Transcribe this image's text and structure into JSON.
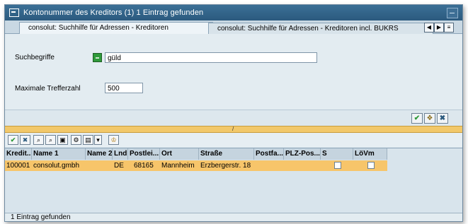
{
  "window": {
    "title": "Kontonummer des Kreditors (1)   1 Eintrag gefunden"
  },
  "tabs": [
    {
      "label": "consolut: Suchhilfe für Adressen - Kreditoren",
      "active": true
    },
    {
      "label": "consolut: Suchhilfe für Adressen - Kreditoren incl. BUKRS",
      "active": false
    }
  ],
  "search": {
    "suchbegriffe_label": "Suchbegriffe",
    "suchbegriffe_value": "güld",
    "max_label": "Maximale Trefferzahl",
    "max_value": "500"
  },
  "columns": [
    "Kredit...",
    "Name 1",
    "Name 2",
    "Lnd",
    "Postlei...",
    "Ort",
    "Straße",
    "Postfa...",
    "PLZ-Pos...",
    "S",
    "LöVm"
  ],
  "rows": [
    {
      "kredit": "100001",
      "name1": "consolut.gmbh",
      "name2": "",
      "lnd": "DE",
      "plz": "68165",
      "ort": "Mannheim",
      "strasse": "Erzbergerstr. 18",
      "postfach": "",
      "plzpos": "",
      "s": false,
      "loevm": false
    }
  ],
  "status": {
    "text": "1 Eintrag gefunden"
  },
  "colors": {
    "title_bar": "#2b5a7e",
    "row_highlight": "#f7c56a",
    "separator": "#f2c86a",
    "panel": "#e3ecf1"
  },
  "icons": [
    "window-icon",
    "minimize-icon",
    "tab-left-icon",
    "tab-right-icon",
    "tab-list-icon",
    "continue-check-icon",
    "multi-select-icon",
    "cancel-icon",
    "apply-check-icon",
    "cancel-x-icon",
    "find-icon",
    "find-next-icon",
    "save-icon",
    "settings-icon",
    "print-icon",
    "dropdown-icon",
    "personal-list-icon"
  ]
}
